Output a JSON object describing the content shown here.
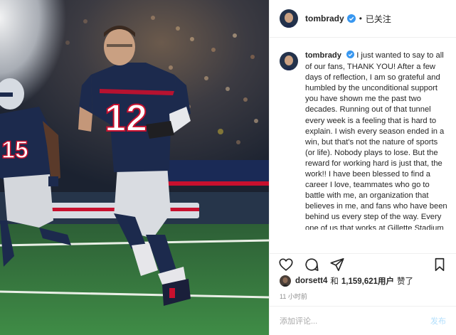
{
  "post": {
    "username": "tombrady",
    "follow_status": "已关注",
    "header_separator": "•",
    "caption_username": "tombrady",
    "caption_text": "I just wanted to say to all of our fans, THANK YOU! After a few days of reflection, I am so grateful and humbled by the unconditional support you have shown me the past two decades. Running out of that tunnel every week is a feeling that is hard to explain. I wish every season ended in a win, but that's not the nature of sports (or life). Nobody plays to lose. But the reward for working hard is just that, the work!! I have been blessed to find a career I love, teammates who go to battle with me, an organization that believes in me, and fans who have been behind us every step of the way. Every one of us that works at Gillette Stadium strived to do their best, spent themselves at a worthy cause, and",
    "liked_by_user": "dorsett4",
    "liked_by_mid": "和",
    "likes_count": "1,159,621用户",
    "liked_suffix": "赞了",
    "timestamp": "11 小时前",
    "comment_placeholder": "添加评论...",
    "post_button": "发布",
    "jersey_main": "12",
    "jersey_left": "15"
  },
  "icons": {
    "like": "heart-icon",
    "comment": "comment-bubble-icon",
    "share": "paper-plane-icon",
    "save": "bookmark-icon",
    "verified": "verified-badge-icon"
  },
  "colors": {
    "verified": "#3897f0",
    "post_button_disabled": "#b2dffc",
    "jersey_navy": "#1c2a4d",
    "jersey_red": "#c8102e",
    "field_green": "#3b8a44"
  }
}
